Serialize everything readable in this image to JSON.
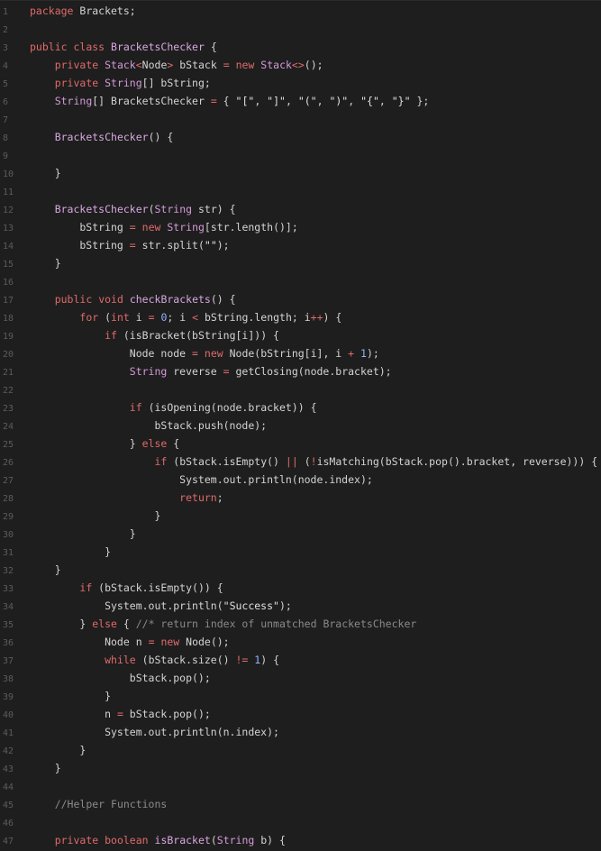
{
  "editor": {
    "language": "java",
    "colors": {
      "background": "#1e1e1e",
      "line_number": "#5c5c5c",
      "keyword": "#e06a6a",
      "type": "#d39ad8",
      "plain": "#d4d4d4",
      "number": "#8fb3ff",
      "comment": "#8a8a8a"
    },
    "lines": [
      {
        "n": "1",
        "tokens": [
          [
            "kw",
            "package"
          ],
          [
            "tx",
            " Brackets;"
          ]
        ]
      },
      {
        "n": "2",
        "tokens": []
      },
      {
        "n": "3",
        "tokens": [
          [
            "kw",
            "public"
          ],
          [
            "tx",
            " "
          ],
          [
            "kw",
            "class"
          ],
          [
            "tx",
            " "
          ],
          [
            "nm",
            "BracketsChecker"
          ],
          [
            "tx",
            " {"
          ]
        ]
      },
      {
        "n": "4",
        "tokens": [
          [
            "tx",
            "    "
          ],
          [
            "kw",
            "private"
          ],
          [
            "tx",
            " "
          ],
          [
            "ty",
            "Stack"
          ],
          [
            "op",
            "<"
          ],
          [
            "tx",
            "Node"
          ],
          [
            "op",
            ">"
          ],
          [
            "tx",
            " bStack "
          ],
          [
            "op",
            "="
          ],
          [
            "tx",
            " "
          ],
          [
            "kw",
            "new"
          ],
          [
            "tx",
            " "
          ],
          [
            "ty",
            "Stack"
          ],
          [
            "op",
            "<>"
          ],
          [
            "tx",
            "();"
          ]
        ]
      },
      {
        "n": "5",
        "tokens": [
          [
            "tx",
            "    "
          ],
          [
            "kw",
            "private"
          ],
          [
            "tx",
            " "
          ],
          [
            "ty",
            "String"
          ],
          [
            "tx",
            "[] bString;"
          ]
        ]
      },
      {
        "n": "6",
        "tokens": [
          [
            "tx",
            "    "
          ],
          [
            "ty",
            "String"
          ],
          [
            "tx",
            "[] BracketsChecker "
          ],
          [
            "op",
            "="
          ],
          [
            "tx",
            " { "
          ],
          [
            "st",
            "\"[\""
          ],
          [
            "tx",
            ", "
          ],
          [
            "st",
            "\"]\""
          ],
          [
            "tx",
            ", "
          ],
          [
            "st",
            "\"(\""
          ],
          [
            "tx",
            ", "
          ],
          [
            "st",
            "\")\""
          ],
          [
            "tx",
            ", "
          ],
          [
            "st",
            "\"{\""
          ],
          [
            "tx",
            ", "
          ],
          [
            "st",
            "\"}\""
          ],
          [
            "tx",
            " };"
          ]
        ]
      },
      {
        "n": "7",
        "tokens": []
      },
      {
        "n": "8",
        "tokens": [
          [
            "tx",
            "    "
          ],
          [
            "nm",
            "BracketsChecker"
          ],
          [
            "tx",
            "() {"
          ]
        ]
      },
      {
        "n": "9",
        "tokens": []
      },
      {
        "n": "10",
        "tokens": [
          [
            "tx",
            "    }"
          ]
        ]
      },
      {
        "n": "11",
        "tokens": []
      },
      {
        "n": "12",
        "tokens": [
          [
            "tx",
            "    "
          ],
          [
            "nm",
            "BracketsChecker"
          ],
          [
            "tx",
            "("
          ],
          [
            "ty",
            "String"
          ],
          [
            "tx",
            " str) {"
          ]
        ]
      },
      {
        "n": "13",
        "tokens": [
          [
            "tx",
            "        bString "
          ],
          [
            "op",
            "="
          ],
          [
            "tx",
            " "
          ],
          [
            "kw",
            "new"
          ],
          [
            "tx",
            " "
          ],
          [
            "ty",
            "String"
          ],
          [
            "tx",
            "[str.length()];"
          ]
        ]
      },
      {
        "n": "14",
        "tokens": [
          [
            "tx",
            "        bString "
          ],
          [
            "op",
            "="
          ],
          [
            "tx",
            " str.split("
          ],
          [
            "st",
            "\"\""
          ],
          [
            "tx",
            ");"
          ]
        ]
      },
      {
        "n": "15",
        "tokens": [
          [
            "tx",
            "    }"
          ]
        ]
      },
      {
        "n": "16",
        "tokens": []
      },
      {
        "n": "17",
        "tokens": [
          [
            "tx",
            "    "
          ],
          [
            "kw",
            "public"
          ],
          [
            "tx",
            " "
          ],
          [
            "kw",
            "void"
          ],
          [
            "tx",
            " "
          ],
          [
            "nm",
            "checkBrackets"
          ],
          [
            "tx",
            "() {"
          ]
        ]
      },
      {
        "n": "18",
        "tokens": [
          [
            "tx",
            "        "
          ],
          [
            "kw",
            "for"
          ],
          [
            "tx",
            " ("
          ],
          [
            "kw",
            "int"
          ],
          [
            "tx",
            " i "
          ],
          [
            "op",
            "="
          ],
          [
            "tx",
            " "
          ],
          [
            "nu",
            "0"
          ],
          [
            "tx",
            "; i "
          ],
          [
            "op",
            "<"
          ],
          [
            "tx",
            " bString.length; i"
          ],
          [
            "op",
            "++"
          ],
          [
            "tx",
            ") {"
          ]
        ]
      },
      {
        "n": "19",
        "tokens": [
          [
            "tx",
            "            "
          ],
          [
            "kw",
            "if"
          ],
          [
            "tx",
            " (isBracket(bString[i])) {"
          ]
        ]
      },
      {
        "n": "20",
        "tokens": [
          [
            "tx",
            "                Node node "
          ],
          [
            "op",
            "="
          ],
          [
            "tx",
            " "
          ],
          [
            "kw",
            "new"
          ],
          [
            "tx",
            " Node(bString[i], i "
          ],
          [
            "op",
            "+"
          ],
          [
            "tx",
            " "
          ],
          [
            "nu",
            "1"
          ],
          [
            "tx",
            ");"
          ]
        ]
      },
      {
        "n": "21",
        "tokens": [
          [
            "tx",
            "                "
          ],
          [
            "ty",
            "String"
          ],
          [
            "tx",
            " reverse "
          ],
          [
            "op",
            "="
          ],
          [
            "tx",
            " getClosing(node.bracket);"
          ]
        ]
      },
      {
        "n": "22",
        "tokens": []
      },
      {
        "n": "23",
        "tokens": [
          [
            "tx",
            "                "
          ],
          [
            "kw",
            "if"
          ],
          [
            "tx",
            " (isOpening(node.bracket)) {"
          ]
        ]
      },
      {
        "n": "24",
        "tokens": [
          [
            "tx",
            "                    bStack.push(node);"
          ]
        ]
      },
      {
        "n": "25",
        "tokens": [
          [
            "tx",
            "                } "
          ],
          [
            "kw",
            "else"
          ],
          [
            "tx",
            " {"
          ]
        ]
      },
      {
        "n": "26",
        "tokens": [
          [
            "tx",
            "                    "
          ],
          [
            "kw",
            "if"
          ],
          [
            "tx",
            " (bStack.isEmpty() "
          ],
          [
            "op",
            "||"
          ],
          [
            "tx",
            " ("
          ],
          [
            "op",
            "!"
          ],
          [
            "tx",
            "isMatching(bStack.pop().bracket, reverse))) {"
          ]
        ]
      },
      {
        "n": "27",
        "tokens": [
          [
            "tx",
            "                        System.out.println(node.index);"
          ]
        ]
      },
      {
        "n": "28",
        "tokens": [
          [
            "tx",
            "                        "
          ],
          [
            "kw",
            "return"
          ],
          [
            "tx",
            ";"
          ]
        ]
      },
      {
        "n": "29",
        "tokens": [
          [
            "tx",
            "                    }"
          ]
        ]
      },
      {
        "n": "30",
        "tokens": [
          [
            "tx",
            "                }"
          ]
        ]
      },
      {
        "n": "31",
        "tokens": [
          [
            "tx",
            "            }"
          ]
        ]
      },
      {
        "n": "32",
        "tokens": [
          [
            "tx",
            "    }"
          ]
        ]
      },
      {
        "n": "33",
        "tokens": [
          [
            "tx",
            "        "
          ],
          [
            "kw",
            "if"
          ],
          [
            "tx",
            " (bStack.isEmpty()) {"
          ]
        ]
      },
      {
        "n": "34",
        "tokens": [
          [
            "tx",
            "            System.out.println("
          ],
          [
            "st",
            "\"Success\""
          ],
          [
            "tx",
            ");"
          ]
        ]
      },
      {
        "n": "35",
        "tokens": [
          [
            "tx",
            "        } "
          ],
          [
            "kw",
            "else"
          ],
          [
            "tx",
            " { "
          ],
          [
            "cm",
            "//* return index of unmatched BracketsChecker"
          ]
        ]
      },
      {
        "n": "36",
        "tokens": [
          [
            "tx",
            "            Node n "
          ],
          [
            "op",
            "="
          ],
          [
            "tx",
            " "
          ],
          [
            "kw",
            "new"
          ],
          [
            "tx",
            " Node();"
          ]
        ]
      },
      {
        "n": "37",
        "tokens": [
          [
            "tx",
            "            "
          ],
          [
            "kw",
            "while"
          ],
          [
            "tx",
            " (bStack.size() "
          ],
          [
            "op",
            "!="
          ],
          [
            "tx",
            " "
          ],
          [
            "nu",
            "1"
          ],
          [
            "tx",
            ") {"
          ]
        ]
      },
      {
        "n": "38",
        "tokens": [
          [
            "tx",
            "                bStack.pop();"
          ]
        ]
      },
      {
        "n": "39",
        "tokens": [
          [
            "tx",
            "            }"
          ]
        ]
      },
      {
        "n": "40",
        "tokens": [
          [
            "tx",
            "            n "
          ],
          [
            "op",
            "="
          ],
          [
            "tx",
            " bStack.pop();"
          ]
        ]
      },
      {
        "n": "41",
        "tokens": [
          [
            "tx",
            "            System.out.println(n.index);"
          ]
        ]
      },
      {
        "n": "42",
        "tokens": [
          [
            "tx",
            "        }"
          ]
        ]
      },
      {
        "n": "43",
        "tokens": [
          [
            "tx",
            "    }"
          ]
        ]
      },
      {
        "n": "44",
        "tokens": []
      },
      {
        "n": "45",
        "tokens": [
          [
            "tx",
            "    "
          ],
          [
            "cm",
            "//Helper Functions"
          ]
        ]
      },
      {
        "n": "46",
        "tokens": []
      },
      {
        "n": "47",
        "tokens": [
          [
            "tx",
            "    "
          ],
          [
            "kw",
            "private"
          ],
          [
            "tx",
            " "
          ],
          [
            "kw",
            "boolean"
          ],
          [
            "tx",
            " "
          ],
          [
            "nm",
            "isBracket"
          ],
          [
            "tx",
            "("
          ],
          [
            "ty",
            "String"
          ],
          [
            "tx",
            " b) {"
          ]
        ]
      }
    ]
  }
}
